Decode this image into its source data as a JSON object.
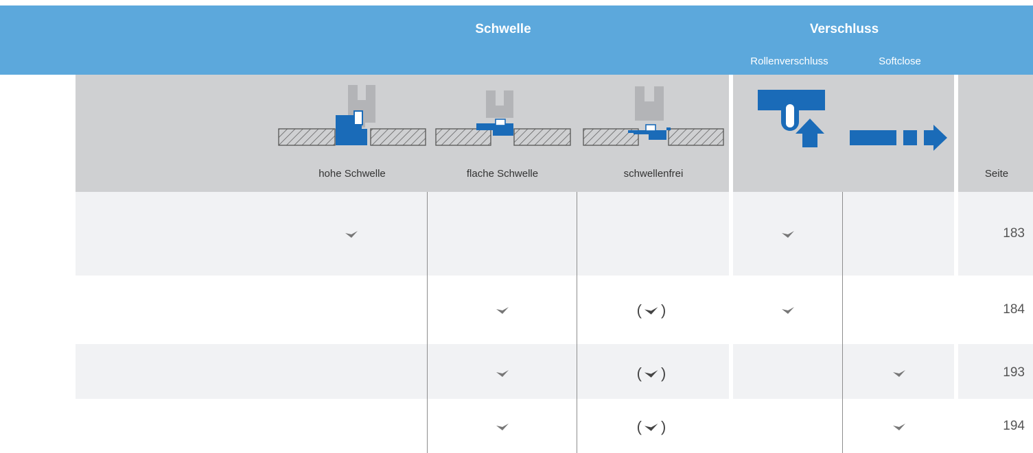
{
  "header": {
    "schwelle_title": "Schwelle",
    "verschluss_title": "Verschluss",
    "sub_rollenverschluss": "Rollenverschluss",
    "sub_softclose": "Softclose"
  },
  "columns": {
    "hohe": "hohe Schwelle",
    "flache": "flache Schwelle",
    "frei": "schwellenfrei",
    "seite": "Seite"
  },
  "colors": {
    "header_blue": "#5ca8dc",
    "icon_blue": "#1a6bb8",
    "gray_panel": "#cfd0d2",
    "row_stripe": "#f1f2f4"
  },
  "icons": {
    "hohe": "high-threshold-icon",
    "flache": "flat-threshold-icon",
    "frei": "threshold-free-icon",
    "roll": "roller-latch-icon",
    "soft": "softclose-arrow-icon",
    "check": "check-icon"
  },
  "rows": [
    {
      "page": "183",
      "hohe": "check",
      "flache": "",
      "frei": "",
      "roll": "check",
      "soft": ""
    },
    {
      "page": "184",
      "hohe": "",
      "flache": "check",
      "frei": "(check)",
      "roll": "check",
      "soft": ""
    },
    {
      "page": "193",
      "hohe": "",
      "flache": "check",
      "frei": "(check)",
      "roll": "",
      "soft": "check"
    },
    {
      "page": "194",
      "hohe": "",
      "flache": "check",
      "frei": "(check)",
      "roll": "",
      "soft": "check"
    }
  ],
  "paren_left": "(",
  "paren_right": ")"
}
